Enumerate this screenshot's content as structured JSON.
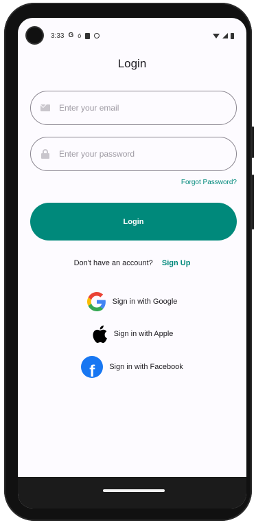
{
  "status_bar": {
    "time": "3:33",
    "icons": [
      "google-icon",
      "wind-icon",
      "sim-card-icon",
      "settings-circle-icon",
      "wifi-icon",
      "signal-icon",
      "battery-icon"
    ],
    "g_label": "G",
    "small_icon_label": "ó"
  },
  "page": {
    "title": "Login"
  },
  "form": {
    "email_placeholder": "Enter your email",
    "password_placeholder": "Enter your password",
    "forgot_password": "Forgot Password?",
    "login_button": "Login"
  },
  "signup": {
    "prompt": "Don't have an account?",
    "link": "Sign Up"
  },
  "social_logins": {
    "google": "Sign in with Google",
    "apple": "Sign in with Apple",
    "facebook": "Sign in with Facebook",
    "facebook_letter": "f"
  },
  "colors": {
    "accent": "#00897b",
    "facebook": "#1877f2",
    "background": "#fdfbff"
  }
}
